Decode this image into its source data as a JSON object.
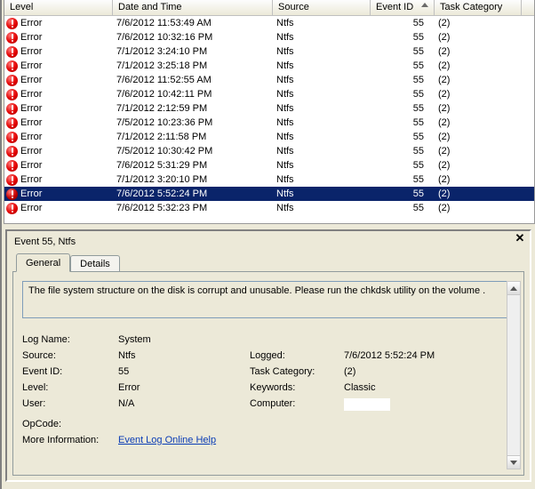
{
  "grid": {
    "columns": {
      "level": "Level",
      "datetime": "Date and Time",
      "source": "Source",
      "event_id": "Event ID",
      "task": "Task Category"
    },
    "rows": [
      {
        "level": "Error",
        "dt": "7/6/2012 11:53:49 AM",
        "src": "Ntfs",
        "eid": "55",
        "task": "(2)"
      },
      {
        "level": "Error",
        "dt": "7/6/2012 10:32:16 PM",
        "src": "Ntfs",
        "eid": "55",
        "task": "(2)"
      },
      {
        "level": "Error",
        "dt": "7/1/2012 3:24:10 PM",
        "src": "Ntfs",
        "eid": "55",
        "task": "(2)"
      },
      {
        "level": "Error",
        "dt": "7/1/2012 3:25:18 PM",
        "src": "Ntfs",
        "eid": "55",
        "task": "(2)"
      },
      {
        "level": "Error",
        "dt": "7/6/2012 11:52:55 AM",
        "src": "Ntfs",
        "eid": "55",
        "task": "(2)"
      },
      {
        "level": "Error",
        "dt": "7/6/2012 10:42:11 PM",
        "src": "Ntfs",
        "eid": "55",
        "task": "(2)"
      },
      {
        "level": "Error",
        "dt": "7/1/2012 2:12:59 PM",
        "src": "Ntfs",
        "eid": "55",
        "task": "(2)"
      },
      {
        "level": "Error",
        "dt": "7/5/2012 10:23:36 PM",
        "src": "Ntfs",
        "eid": "55",
        "task": "(2)"
      },
      {
        "level": "Error",
        "dt": "7/1/2012 2:11:58 PM",
        "src": "Ntfs",
        "eid": "55",
        "task": "(2)"
      },
      {
        "level": "Error",
        "dt": "7/5/2012 10:30:42 PM",
        "src": "Ntfs",
        "eid": "55",
        "task": "(2)"
      },
      {
        "level": "Error",
        "dt": "7/6/2012 5:31:29 PM",
        "src": "Ntfs",
        "eid": "55",
        "task": "(2)"
      },
      {
        "level": "Error",
        "dt": "7/1/2012 3:20:10 PM",
        "src": "Ntfs",
        "eid": "55",
        "task": "(2)"
      },
      {
        "level": "Error",
        "dt": "7/6/2012 5:52:24 PM",
        "src": "Ntfs",
        "eid": "55",
        "task": "(2)"
      },
      {
        "level": "Error",
        "dt": "7/6/2012 5:32:23 PM",
        "src": "Ntfs",
        "eid": "55",
        "task": "(2)"
      }
    ],
    "selected_index": 12
  },
  "details": {
    "title": "Event 55, Ntfs",
    "tabs": {
      "general": "General",
      "details": "Details"
    },
    "message": "The file system structure on the disk is corrupt and unusable. Please run the chkdsk utility on the volume .",
    "props": {
      "log_name_lbl": "Log Name:",
      "log_name_val": "System",
      "source_lbl": "Source:",
      "source_val": "Ntfs",
      "logged_lbl": "Logged:",
      "logged_val": "7/6/2012 5:52:24 PM",
      "event_id_lbl": "Event ID:",
      "event_id_val": "55",
      "task_cat_lbl": "Task Category:",
      "task_cat_val": "(2)",
      "level_lbl": "Level:",
      "level_val": "Error",
      "keywords_lbl": "Keywords:",
      "keywords_val": "Classic",
      "user_lbl": "User:",
      "user_val": "N/A",
      "computer_lbl": "Computer:",
      "computer_val": "",
      "opcode_lbl": "OpCode:",
      "opcode_val": "",
      "moreinfo_lbl": "More Information:",
      "moreinfo_link": "Event Log Online Help"
    }
  }
}
